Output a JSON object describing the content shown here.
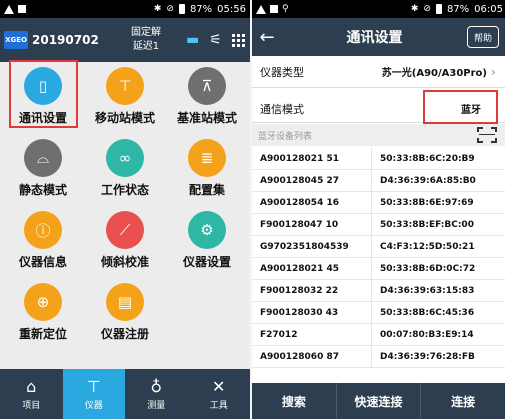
{
  "left": {
    "status": {
      "battery": "87%",
      "time": "05:56"
    },
    "header": {
      "logo_text": "XGEO",
      "date": "20190702",
      "fix_status": "固定解",
      "delay": "延迟1"
    },
    "tiles": [
      {
        "label": "通讯设置",
        "icon": "phone-antenna-icon",
        "color": "#2aa9e0"
      },
      {
        "label": "移动站模式",
        "icon": "rover-receiver-icon",
        "color": "#f5a21b"
      },
      {
        "label": "基准站模式",
        "icon": "base-station-icon",
        "color": "#6f6f6f"
      },
      {
        "label": "静态模式",
        "icon": "static-receiver-icon",
        "color": "#6f6f6f"
      },
      {
        "label": "工作状态",
        "icon": "link-icon",
        "color": "#2db7a4"
      },
      {
        "label": "配置集",
        "icon": "config-stack-icon",
        "color": "#f5a21b"
      },
      {
        "label": "仪器信息",
        "icon": "info-receiver-icon",
        "color": "#f5a21b"
      },
      {
        "label": "倾斜校准",
        "icon": "tilt-icon",
        "color": "#e94f4f"
      },
      {
        "label": "仪器设置",
        "icon": "receiver-settings-icon",
        "color": "#2db7a4"
      },
      {
        "label": "重新定位",
        "icon": "relocate-icon",
        "color": "#f5a21b"
      },
      {
        "label": "仪器注册",
        "icon": "register-icon",
        "color": "#f5a21b"
      }
    ],
    "tabs": [
      {
        "label": "项目",
        "icon": "home-icon",
        "active": false
      },
      {
        "label": "仪器",
        "icon": "receiver-icon",
        "active": true
      },
      {
        "label": "测量",
        "icon": "location-pin-icon",
        "active": false
      },
      {
        "label": "工具",
        "icon": "tools-icon",
        "active": false
      }
    ]
  },
  "right": {
    "status": {
      "battery": "87%",
      "time": "06:05"
    },
    "header": {
      "title": "通讯设置",
      "help_label": "帮助"
    },
    "device_type": {
      "label": "仪器类型",
      "value": "苏一光(A90/A30Pro)"
    },
    "comm_mode": {
      "label": "通信模式",
      "value": "蓝牙"
    },
    "list_header": "蓝牙设备列表",
    "devices": [
      {
        "name": "A900128021 51",
        "mac": "50:33:8B:6C:20:B9"
      },
      {
        "name": "A900128045 27",
        "mac": "D4:36:39:6A:85:B0"
      },
      {
        "name": "A900128054 16",
        "mac": "50:33:8B:6E:97:69"
      },
      {
        "name": "F900128047 10",
        "mac": "50:33:8B:EF:BC:00"
      },
      {
        "name": "G9702351804539",
        "mac": "C4:F3:12:5D:50:21"
      },
      {
        "name": "A900128021 45",
        "mac": "50:33:8B:6D:0C:72"
      },
      {
        "name": "F900128032 22",
        "mac": "D4:36:39:63:15:83"
      },
      {
        "name": "F900128030 43",
        "mac": "50:33:8B:6C:45:36"
      },
      {
        "name": "F27012",
        "mac": "00:07:80:B3:E9:14"
      },
      {
        "name": "A900128060 87",
        "mac": "D4:36:39:76:28:FB"
      }
    ],
    "buttons": {
      "search": "搜索",
      "quick_connect": "快速连接",
      "connect": "连接"
    }
  }
}
